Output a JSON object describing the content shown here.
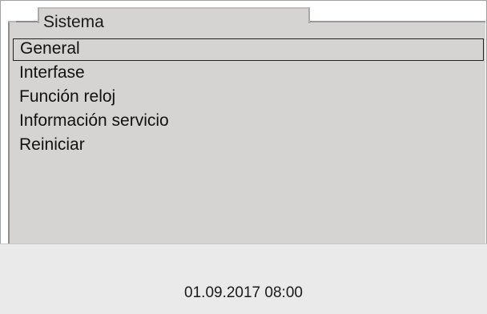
{
  "window": {
    "tab_title": "Sistema"
  },
  "menu": {
    "items": [
      {
        "label": "General",
        "selected": true
      },
      {
        "label": "Interfase",
        "selected": false
      },
      {
        "label": "Función reloj",
        "selected": false
      },
      {
        "label": "Información servicio",
        "selected": false
      },
      {
        "label": "Reiniciar",
        "selected": false
      }
    ]
  },
  "status": {
    "datetime": "01.09.2017 08:00"
  }
}
